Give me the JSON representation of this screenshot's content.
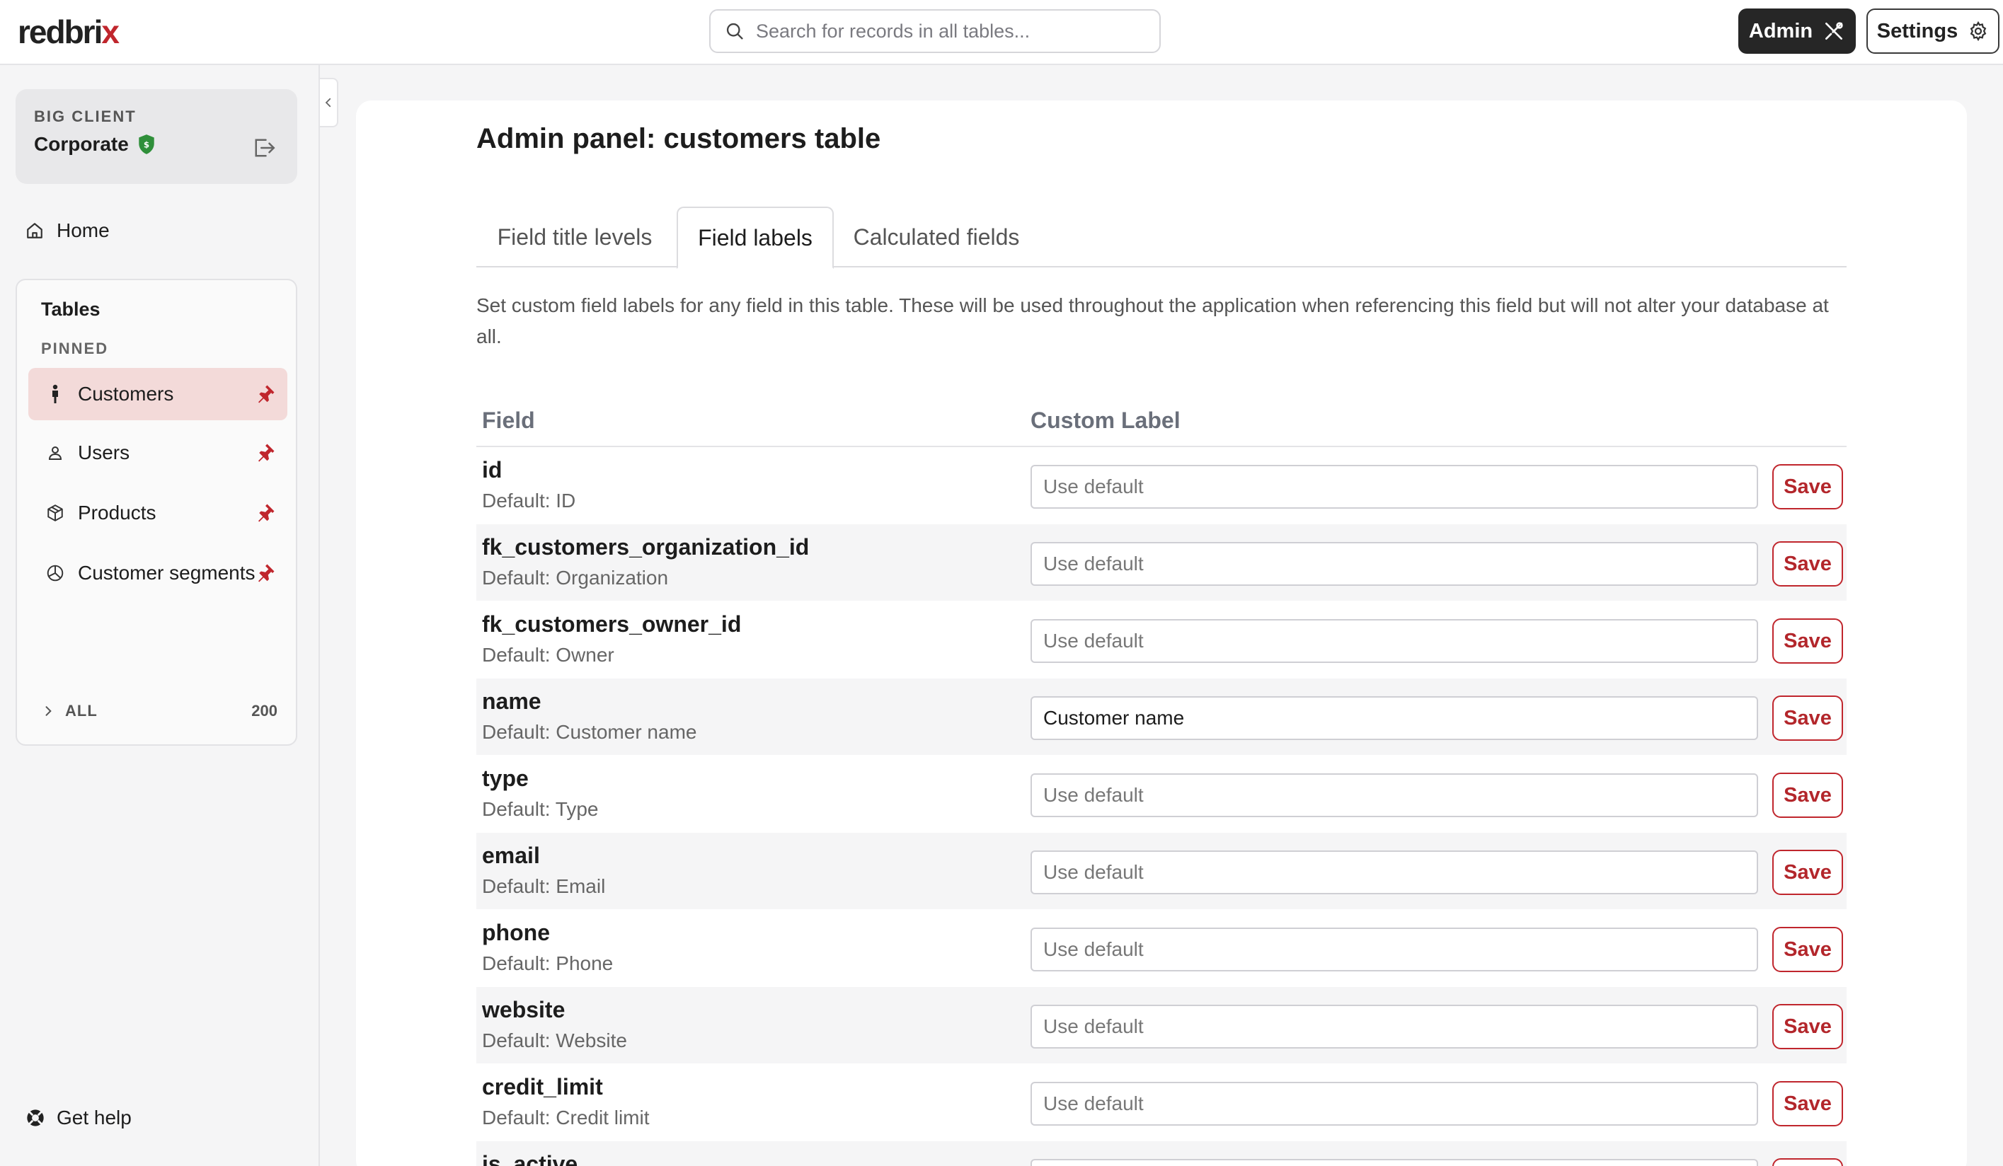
{
  "app": {
    "logo_main": "redbri",
    "logo_x": "x"
  },
  "header": {
    "search_placeholder": "Search for records in all tables...",
    "admin_label": "Admin",
    "settings_label": "Settings"
  },
  "sidebar": {
    "org_kicker": "BIG CLIENT",
    "org_name": "Corporate",
    "home_label": "Home",
    "tables_title": "Tables",
    "pinned_label": "PINNED",
    "items": [
      {
        "label": "Customers",
        "icon": "person-icon",
        "active": true
      },
      {
        "label": "Users",
        "icon": "user-icon",
        "active": false
      },
      {
        "label": "Products",
        "icon": "box-icon",
        "active": false
      },
      {
        "label": "Customer segments",
        "icon": "pie-chart-icon",
        "active": false
      }
    ],
    "all_label": "ALL",
    "all_count": "200",
    "help_label": "Get help"
  },
  "main": {
    "title": "Admin panel: customers table",
    "tabs": [
      {
        "label": "Field title levels",
        "active": false
      },
      {
        "label": "Field labels",
        "active": true
      },
      {
        "label": "Calculated fields",
        "active": false
      }
    ],
    "description": "Set custom field labels for any field in this table. These will be used throughout the application when referencing this field but will not alter your database at all.",
    "col_field": "Field",
    "col_custom_label": "Custom Label",
    "save_label": "Save",
    "input_placeholder": "Use default",
    "rows": [
      {
        "field": "id",
        "default": "Default: ID",
        "value": ""
      },
      {
        "field": "fk_customers_organization_id",
        "default": "Default: Organization",
        "value": ""
      },
      {
        "field": "fk_customers_owner_id",
        "default": "Default: Owner",
        "value": ""
      },
      {
        "field": "name",
        "default": "Default: Customer name",
        "value": "Customer name"
      },
      {
        "field": "type",
        "default": "Default: Type",
        "value": ""
      },
      {
        "field": "email",
        "default": "Default: Email",
        "value": ""
      },
      {
        "field": "phone",
        "default": "Default: Phone",
        "value": ""
      },
      {
        "field": "website",
        "default": "Default: Website",
        "value": ""
      },
      {
        "field": "credit_limit",
        "default": "Default: Credit limit",
        "value": ""
      },
      {
        "field": "is_active",
        "default": "",
        "value": ""
      }
    ]
  },
  "colors": {
    "brand": "#c0262d",
    "active_nav_bg": "#f3dad9",
    "dark_button": "#262626"
  }
}
